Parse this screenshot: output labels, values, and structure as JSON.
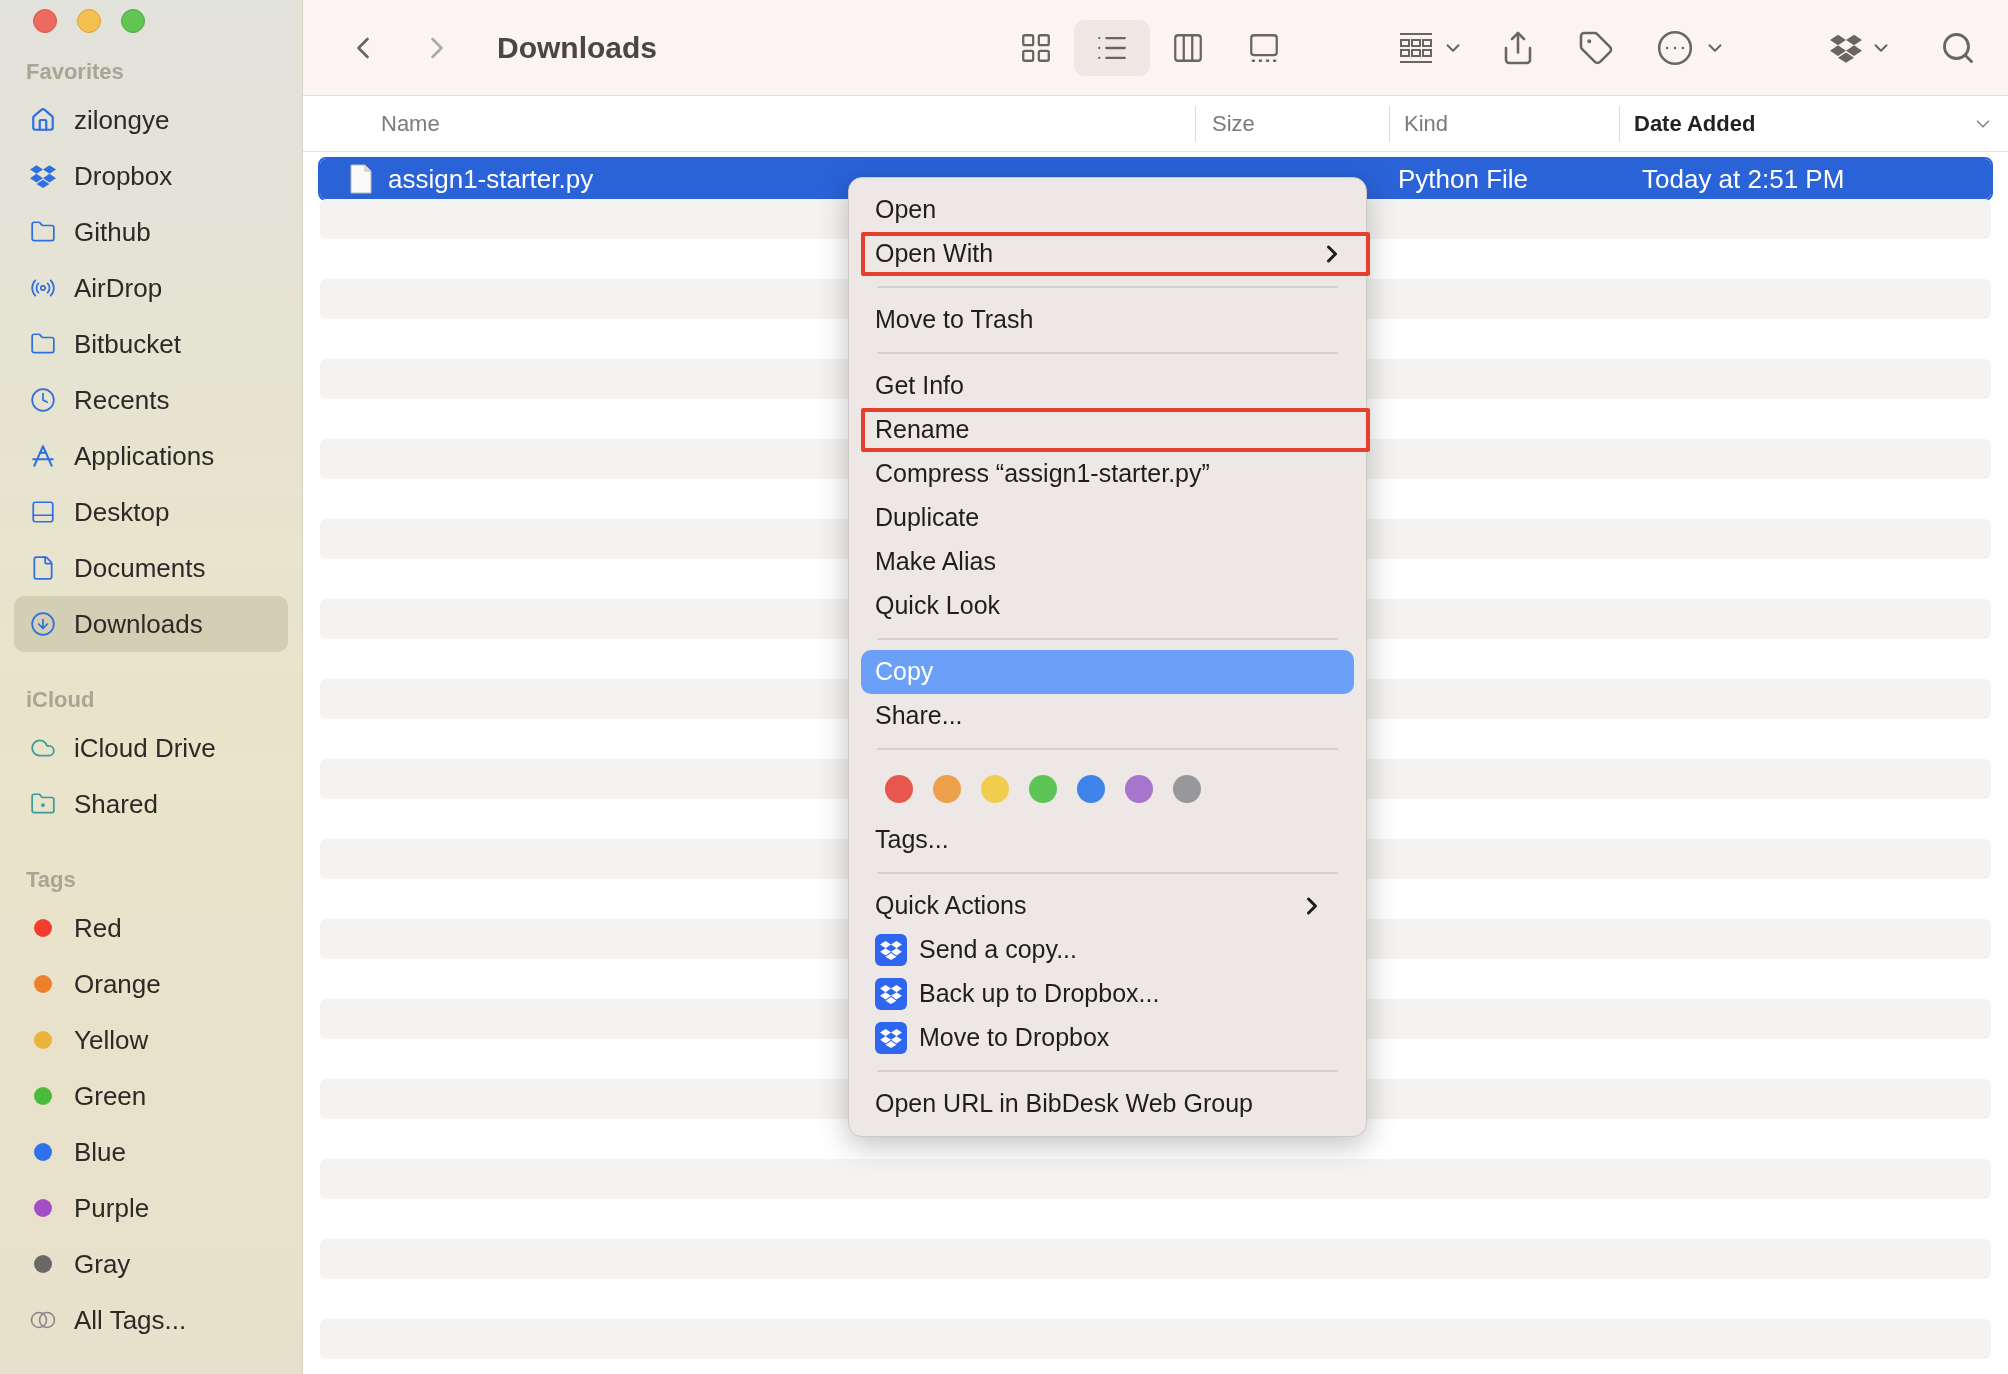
{
  "window": {
    "title": "Downloads"
  },
  "toolbar": {
    "view_modes": [
      {
        "selected": false
      },
      {
        "selected": true
      },
      {
        "selected": false
      },
      {
        "selected": false
      }
    ]
  },
  "sidebar": {
    "sections": [
      {
        "title": "Favorites",
        "items": [
          {
            "label": "zilongye",
            "kind": "location",
            "selected": false
          },
          {
            "label": "Dropbox",
            "kind": "location",
            "selected": false
          },
          {
            "label": "Github",
            "kind": "location",
            "selected": false
          },
          {
            "label": "AirDrop",
            "kind": "location",
            "selected": false
          },
          {
            "label": "Bitbucket",
            "kind": "location",
            "selected": false
          },
          {
            "label": "Recents",
            "kind": "location",
            "selected": false
          },
          {
            "label": "Applications",
            "kind": "location",
            "selected": false
          },
          {
            "label": "Desktop",
            "kind": "location",
            "selected": false
          },
          {
            "label": "Documents",
            "kind": "location",
            "selected": false
          },
          {
            "label": "Downloads",
            "kind": "location",
            "selected": true
          }
        ]
      },
      {
        "title": "iCloud",
        "items": [
          {
            "label": "iCloud Drive",
            "kind": "location",
            "selected": false
          },
          {
            "label": "Shared",
            "kind": "location",
            "selected": false
          }
        ]
      },
      {
        "title": "Tags",
        "items": [
          {
            "label": "Red",
            "kind": "tag",
            "color": "#f23d2f",
            "selected": false
          },
          {
            "label": "Orange",
            "kind": "tag",
            "color": "#ee7f2d",
            "selected": false
          },
          {
            "label": "Yellow",
            "kind": "tag",
            "color": "#eab43a",
            "selected": false
          },
          {
            "label": "Green",
            "kind": "tag",
            "color": "#4bb93a",
            "selected": false
          },
          {
            "label": "Blue",
            "kind": "tag",
            "color": "#2f73ec",
            "selected": false
          },
          {
            "label": "Purple",
            "kind": "tag",
            "color": "#a34ec7",
            "selected": false
          },
          {
            "label": "Gray",
            "kind": "tag",
            "color": "#6b6966",
            "selected": false
          },
          {
            "label": "All Tags...",
            "kind": "all_tags",
            "selected": false
          }
        ]
      }
    ]
  },
  "table": {
    "columns": [
      {
        "label": "Name",
        "sorted": false
      },
      {
        "label": "Size",
        "sorted": false
      },
      {
        "label": "Kind",
        "sorted": false
      },
      {
        "label": "Date Added",
        "sorted": true
      }
    ],
    "rows": [
      {
        "name": "assign1-starter.py",
        "kind": "Python File",
        "date_added": "Today at 2:51 PM",
        "selected": true
      }
    ]
  },
  "context_menu": {
    "items": [
      {
        "kind": "item",
        "label": "Open",
        "submenu": false,
        "selected": false,
        "outlined": false
      },
      {
        "kind": "item",
        "label": "Open With",
        "submenu": true,
        "selected": false,
        "outlined": true
      },
      {
        "kind": "separator"
      },
      {
        "kind": "item",
        "label": "Move to Trash",
        "submenu": false,
        "selected": false,
        "outlined": false
      },
      {
        "kind": "separator"
      },
      {
        "kind": "item",
        "label": "Get Info",
        "submenu": false,
        "selected": false,
        "outlined": false
      },
      {
        "kind": "item",
        "label": "Rename",
        "submenu": false,
        "selected": false,
        "outlined": true
      },
      {
        "kind": "item",
        "label": "Compress “assign1-starter.py”",
        "submenu": false,
        "selected": false,
        "outlined": false
      },
      {
        "kind": "item",
        "label": "Duplicate",
        "submenu": false,
        "selected": false,
        "outlined": false
      },
      {
        "kind": "item",
        "label": "Make Alias",
        "submenu": false,
        "selected": false,
        "outlined": false
      },
      {
        "kind": "item",
        "label": "Quick Look",
        "submenu": false,
        "selected": false,
        "outlined": false
      },
      {
        "kind": "separator"
      },
      {
        "kind": "item",
        "label": "Copy",
        "submenu": false,
        "selected": true,
        "outlined": false
      },
      {
        "kind": "item",
        "label": "Share...",
        "submenu": false,
        "selected": false,
        "outlined": false
      },
      {
        "kind": "separator"
      },
      {
        "kind": "tags",
        "tags": [
          {
            "color": "#e7574d"
          },
          {
            "color": "#eca04a"
          },
          {
            "color": "#f1cd4d"
          },
          {
            "color": "#5cc556"
          },
          {
            "color": "#3f84ea"
          },
          {
            "color": "#a875cc"
          },
          {
            "color": "#98979a"
          }
        ]
      },
      {
        "kind": "item",
        "label": "Tags...",
        "submenu": false,
        "selected": false,
        "outlined": false
      },
      {
        "kind": "separator"
      },
      {
        "kind": "item",
        "label": "Quick Actions",
        "submenu": true,
        "selected": false,
        "outlined": false
      },
      {
        "kind": "dropbox",
        "label": "Send a copy...",
        "submenu": false,
        "selected": false,
        "outlined": false
      },
      {
        "kind": "dropbox",
        "label": "Back up to Dropbox...",
        "submenu": false,
        "selected": false,
        "outlined": false
      },
      {
        "kind": "dropbox",
        "label": "Move to Dropbox",
        "submenu": false,
        "selected": false,
        "outlined": false
      },
      {
        "kind": "separator"
      },
      {
        "kind": "item",
        "label": "Open URL in BibDesk Web Group",
        "submenu": false,
        "selected": false,
        "outlined": false
      }
    ]
  }
}
